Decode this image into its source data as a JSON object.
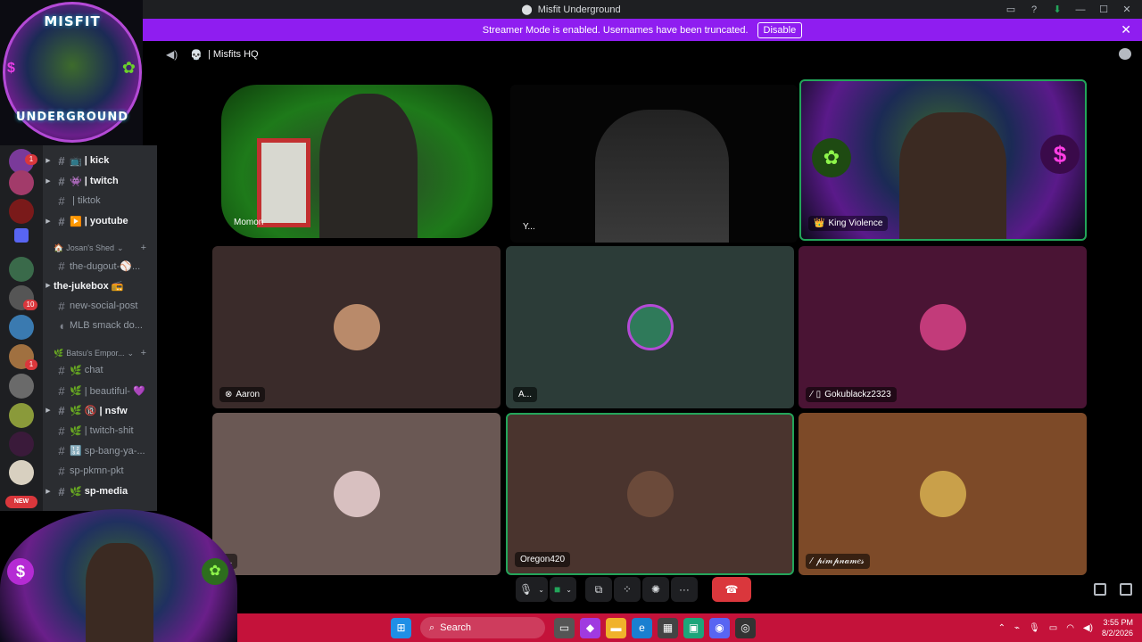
{
  "window": {
    "title": "Misfit Underground",
    "controls": [
      "inbox-icon",
      "help-icon",
      "download-icon",
      "minimize-icon",
      "maximize-icon",
      "close-icon"
    ]
  },
  "banner": {
    "message": "Streamer Mode is enabled. Usernames have been truncated.",
    "button": "Disable"
  },
  "logo": {
    "top": "MISFIT",
    "bottom": "UNDERGROUND",
    "colors": {
      "ring": "#b44ad6",
      "glow": "#33ccff"
    }
  },
  "rail": {
    "badges": [
      "1",
      "10",
      "1"
    ],
    "new_label": "NEW"
  },
  "channels": [
    {
      "type": "text",
      "icon": "📺",
      "name": "| kick",
      "bold": true
    },
    {
      "type": "text",
      "icon": "👾",
      "name": "| twitch",
      "bold": true
    },
    {
      "type": "text",
      "icon": "",
      "name": "| tiktok",
      "bold": false
    },
    {
      "type": "text",
      "icon": "▶️",
      "name": "| youtube",
      "bold": true
    },
    {
      "type": "category",
      "icon": "🏠",
      "name": "Josan's Shed"
    },
    {
      "type": "text",
      "icon": "",
      "name": "the-dugout-⚾...",
      "bold": false
    },
    {
      "type": "text",
      "icon": "",
      "name": "the-jukebox 📻",
      "bold": true
    },
    {
      "type": "text",
      "icon": "",
      "name": "new-social-post",
      "bold": false
    },
    {
      "type": "voice",
      "icon": "",
      "name": "MLB smack do...",
      "bold": false
    },
    {
      "type": "category",
      "icon": "🌿",
      "name": "Batsu's Empor..."
    },
    {
      "type": "text",
      "icon": "🌿",
      "name": "chat",
      "bold": false
    },
    {
      "type": "text",
      "icon": "🌿",
      "name": "| beautiful- 💜",
      "bold": false
    },
    {
      "type": "text",
      "icon": "🌿",
      "name": "🔞 | nsfw",
      "bold": true
    },
    {
      "type": "text",
      "icon": "🌿",
      "name": "| twitch-shit",
      "bold": false
    },
    {
      "type": "text",
      "icon": "",
      "name": "🔢 sp-bang-ya-...",
      "bold": false
    },
    {
      "type": "text",
      "icon": "",
      "name": "sp-pkmn-pkt",
      "bold": false
    },
    {
      "type": "text",
      "icon": "🌿",
      "name": "sp-media",
      "bold": true
    }
  ],
  "voice": {
    "channel": "| Misfits HQ",
    "icon": "💀"
  },
  "participants": [
    {
      "name": "Momon",
      "video": true,
      "bg": "#1e7a1a"
    },
    {
      "name": "Y...",
      "video": true,
      "bg": "#050505"
    },
    {
      "name": "King Violence",
      "video": true,
      "bg": "#2a1a4a",
      "prefix": "👑"
    },
    {
      "name": "Aaron",
      "video": false,
      "bg": "#3a2b2a",
      "avatar": "#b98a6a",
      "prefix": "xbox-icon"
    },
    {
      "name": "A...",
      "video": false,
      "bg": "#2c3c38",
      "avatar": "#2f7a5a"
    },
    {
      "name": "Gokublackz2323",
      "video": false,
      "bg": "#4a1434",
      "avatar": "#c23b7a",
      "prefix": "mute-phone-icon"
    },
    {
      "name": "...",
      "video": false,
      "bg": "#6a5854",
      "avatar": "#d8c0c0"
    },
    {
      "name": "Oregon420",
      "video": false,
      "bg": "#4a342e",
      "avatar": "#6b4a3a",
      "speaking": true
    },
    {
      "name": "𝓅𝒾𝓂𝓅𝓃𝒶𝓂𝑒𝓈",
      "video": false,
      "bg": "#7d4a28",
      "avatar": "#c9a04a",
      "prefix": "deafen-icon"
    }
  ],
  "taskbar": {
    "search_placeholder": "Search",
    "time": "3:55 PM",
    "date": "8/2/2026"
  }
}
